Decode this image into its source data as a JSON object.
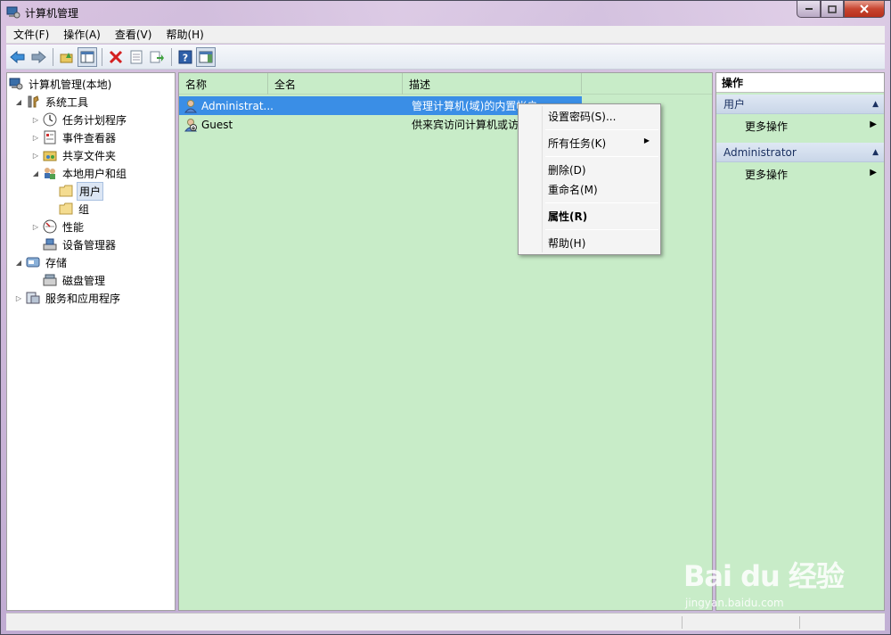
{
  "window": {
    "title": "计算机管理",
    "accent_close": "#c74530"
  },
  "menubar": {
    "items": [
      "文件(F)",
      "操作(A)",
      "查看(V)",
      "帮助(H)"
    ]
  },
  "toolbar": {
    "buttons": [
      "back-icon",
      "forward-icon",
      "up-folder-icon",
      "show-tree-icon",
      "delete-icon",
      "properties-icon",
      "export-icon",
      "help-icon",
      "show-action-pane-icon"
    ]
  },
  "tree": {
    "items": [
      {
        "label": "计算机管理(本地)",
        "icon": "computer-management-icon",
        "arrow": ""
      },
      {
        "label": "系统工具",
        "icon": "tools-icon",
        "arrow": "◢"
      },
      {
        "label": "任务计划程序",
        "icon": "clock-icon",
        "arrow": "▷"
      },
      {
        "label": "事件查看器",
        "icon": "event-viewer-icon",
        "arrow": "▷"
      },
      {
        "label": "共享文件夹",
        "icon": "shared-folder-icon",
        "arrow": "▷"
      },
      {
        "label": "本地用户和组",
        "icon": "users-groups-icon",
        "arrow": "◢"
      },
      {
        "label": "用户",
        "icon": "folder-icon",
        "arrow": ""
      },
      {
        "label": "组",
        "icon": "folder-icon",
        "arrow": ""
      },
      {
        "label": "性能",
        "icon": "performance-icon",
        "arrow": "▷"
      },
      {
        "label": "设备管理器",
        "icon": "device-manager-icon",
        "arrow": ""
      },
      {
        "label": "存储",
        "icon": "storage-icon",
        "arrow": "◢"
      },
      {
        "label": "磁盘管理",
        "icon": "disk-management-icon",
        "arrow": ""
      },
      {
        "label": "服务和应用程序",
        "icon": "services-icon",
        "arrow": "▷"
      }
    ]
  },
  "list": {
    "columns": [
      "名称",
      "全名",
      "描述"
    ],
    "rows": [
      {
        "name": "Administrat...",
        "fullname": "",
        "description": "管理计算机(域)的内置帐户"
      },
      {
        "name": "Guest",
        "fullname": "",
        "description": "供来宾访问计算机或访"
      }
    ]
  },
  "context_menu": {
    "items": [
      "设置密码(S)...",
      "所有任务(K)",
      "删除(D)",
      "重命名(M)",
      "属性(R)",
      "帮助(H)"
    ]
  },
  "actions": {
    "title": "操作",
    "sections": [
      {
        "title": "用户",
        "item": "更多操作"
      },
      {
        "title": "Administrator",
        "item": "更多操作"
      }
    ]
  },
  "watermark": {
    "logo": "Bai du 经验",
    "url": "jingyan.baidu.com"
  }
}
